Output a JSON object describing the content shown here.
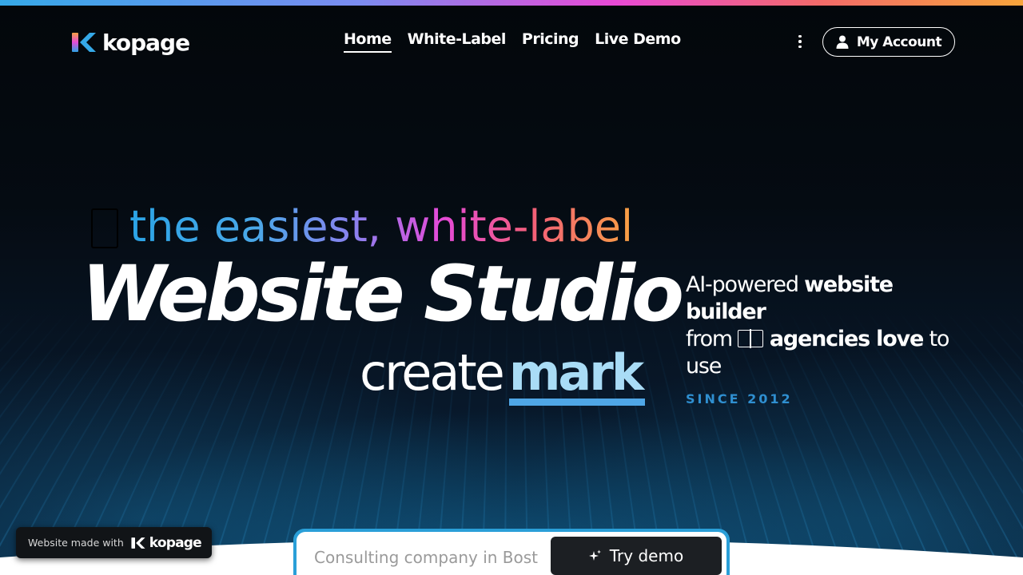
{
  "brand": {
    "name": "kopage",
    "logo_icon": "kopage-logo-icon"
  },
  "nav": {
    "items": [
      {
        "label": "Home",
        "active": true
      },
      {
        "label": "White-Label",
        "active": false
      },
      {
        "label": "Pricing",
        "active": false
      },
      {
        "label": "Live Demo",
        "active": false
      }
    ],
    "more_icon": "kebab-menu-icon",
    "account_label": "My Account",
    "account_icon": "user-icon"
  },
  "hero": {
    "tagline_prefix": "the easiest, white-label",
    "headline": "Website Studio",
    "create_word": "create",
    "rotating_word": "mark",
    "side_copy": {
      "line_part1": "AI-powered ",
      "line_part1_bold": "website builder",
      "from": "from",
      "bold2": "agencies love",
      "to_use": "to use"
    },
    "since": "SINCE 2012"
  },
  "demo": {
    "placeholder": "Consulting company in Bost",
    "button_label": "Try demo",
    "button_icon": "sparkle-icon"
  },
  "badge": {
    "label": "Website made with",
    "logo_text": "kopage"
  },
  "colors": {
    "accent_blue": "#2f8fd0",
    "gradient_start": "#2ba4e6",
    "gradient_mid": "#e54ad8",
    "gradient_end": "#f8a043",
    "background": "#04080d"
  }
}
